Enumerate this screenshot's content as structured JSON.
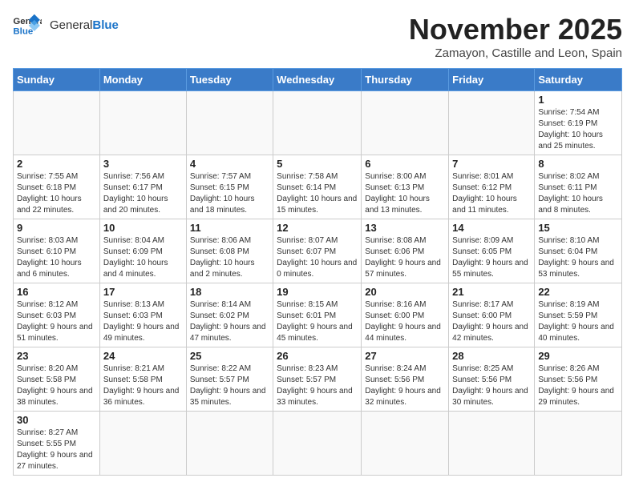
{
  "header": {
    "logo_general": "General",
    "logo_blue": "Blue",
    "month": "November 2025",
    "location": "Zamayon, Castille and Leon, Spain"
  },
  "weekdays": [
    "Sunday",
    "Monday",
    "Tuesday",
    "Wednesday",
    "Thursday",
    "Friday",
    "Saturday"
  ],
  "weeks": [
    [
      {
        "day": "",
        "info": ""
      },
      {
        "day": "",
        "info": ""
      },
      {
        "day": "",
        "info": ""
      },
      {
        "day": "",
        "info": ""
      },
      {
        "day": "",
        "info": ""
      },
      {
        "day": "",
        "info": ""
      },
      {
        "day": "1",
        "info": "Sunrise: 7:54 AM\nSunset: 6:19 PM\nDaylight: 10 hours and 25 minutes."
      }
    ],
    [
      {
        "day": "2",
        "info": "Sunrise: 7:55 AM\nSunset: 6:18 PM\nDaylight: 10 hours and 22 minutes."
      },
      {
        "day": "3",
        "info": "Sunrise: 7:56 AM\nSunset: 6:17 PM\nDaylight: 10 hours and 20 minutes."
      },
      {
        "day": "4",
        "info": "Sunrise: 7:57 AM\nSunset: 6:15 PM\nDaylight: 10 hours and 18 minutes."
      },
      {
        "day": "5",
        "info": "Sunrise: 7:58 AM\nSunset: 6:14 PM\nDaylight: 10 hours and 15 minutes."
      },
      {
        "day": "6",
        "info": "Sunrise: 8:00 AM\nSunset: 6:13 PM\nDaylight: 10 hours and 13 minutes."
      },
      {
        "day": "7",
        "info": "Sunrise: 8:01 AM\nSunset: 6:12 PM\nDaylight: 10 hours and 11 minutes."
      },
      {
        "day": "8",
        "info": "Sunrise: 8:02 AM\nSunset: 6:11 PM\nDaylight: 10 hours and 8 minutes."
      }
    ],
    [
      {
        "day": "9",
        "info": "Sunrise: 8:03 AM\nSunset: 6:10 PM\nDaylight: 10 hours and 6 minutes."
      },
      {
        "day": "10",
        "info": "Sunrise: 8:04 AM\nSunset: 6:09 PM\nDaylight: 10 hours and 4 minutes."
      },
      {
        "day": "11",
        "info": "Sunrise: 8:06 AM\nSunset: 6:08 PM\nDaylight: 10 hours and 2 minutes."
      },
      {
        "day": "12",
        "info": "Sunrise: 8:07 AM\nSunset: 6:07 PM\nDaylight: 10 hours and 0 minutes."
      },
      {
        "day": "13",
        "info": "Sunrise: 8:08 AM\nSunset: 6:06 PM\nDaylight: 9 hours and 57 minutes."
      },
      {
        "day": "14",
        "info": "Sunrise: 8:09 AM\nSunset: 6:05 PM\nDaylight: 9 hours and 55 minutes."
      },
      {
        "day": "15",
        "info": "Sunrise: 8:10 AM\nSunset: 6:04 PM\nDaylight: 9 hours and 53 minutes."
      }
    ],
    [
      {
        "day": "16",
        "info": "Sunrise: 8:12 AM\nSunset: 6:03 PM\nDaylight: 9 hours and 51 minutes."
      },
      {
        "day": "17",
        "info": "Sunrise: 8:13 AM\nSunset: 6:03 PM\nDaylight: 9 hours and 49 minutes."
      },
      {
        "day": "18",
        "info": "Sunrise: 8:14 AM\nSunset: 6:02 PM\nDaylight: 9 hours and 47 minutes."
      },
      {
        "day": "19",
        "info": "Sunrise: 8:15 AM\nSunset: 6:01 PM\nDaylight: 9 hours and 45 minutes."
      },
      {
        "day": "20",
        "info": "Sunrise: 8:16 AM\nSunset: 6:00 PM\nDaylight: 9 hours and 44 minutes."
      },
      {
        "day": "21",
        "info": "Sunrise: 8:17 AM\nSunset: 6:00 PM\nDaylight: 9 hours and 42 minutes."
      },
      {
        "day": "22",
        "info": "Sunrise: 8:19 AM\nSunset: 5:59 PM\nDaylight: 9 hours and 40 minutes."
      }
    ],
    [
      {
        "day": "23",
        "info": "Sunrise: 8:20 AM\nSunset: 5:58 PM\nDaylight: 9 hours and 38 minutes."
      },
      {
        "day": "24",
        "info": "Sunrise: 8:21 AM\nSunset: 5:58 PM\nDaylight: 9 hours and 36 minutes."
      },
      {
        "day": "25",
        "info": "Sunrise: 8:22 AM\nSunset: 5:57 PM\nDaylight: 9 hours and 35 minutes."
      },
      {
        "day": "26",
        "info": "Sunrise: 8:23 AM\nSunset: 5:57 PM\nDaylight: 9 hours and 33 minutes."
      },
      {
        "day": "27",
        "info": "Sunrise: 8:24 AM\nSunset: 5:56 PM\nDaylight: 9 hours and 32 minutes."
      },
      {
        "day": "28",
        "info": "Sunrise: 8:25 AM\nSunset: 5:56 PM\nDaylight: 9 hours and 30 minutes."
      },
      {
        "day": "29",
        "info": "Sunrise: 8:26 AM\nSunset: 5:56 PM\nDaylight: 9 hours and 29 minutes."
      }
    ],
    [
      {
        "day": "30",
        "info": "Sunrise: 8:27 AM\nSunset: 5:55 PM\nDaylight: 9 hours and 27 minutes."
      },
      {
        "day": "",
        "info": ""
      },
      {
        "day": "",
        "info": ""
      },
      {
        "day": "",
        "info": ""
      },
      {
        "day": "",
        "info": ""
      },
      {
        "day": "",
        "info": ""
      },
      {
        "day": "",
        "info": ""
      }
    ]
  ]
}
